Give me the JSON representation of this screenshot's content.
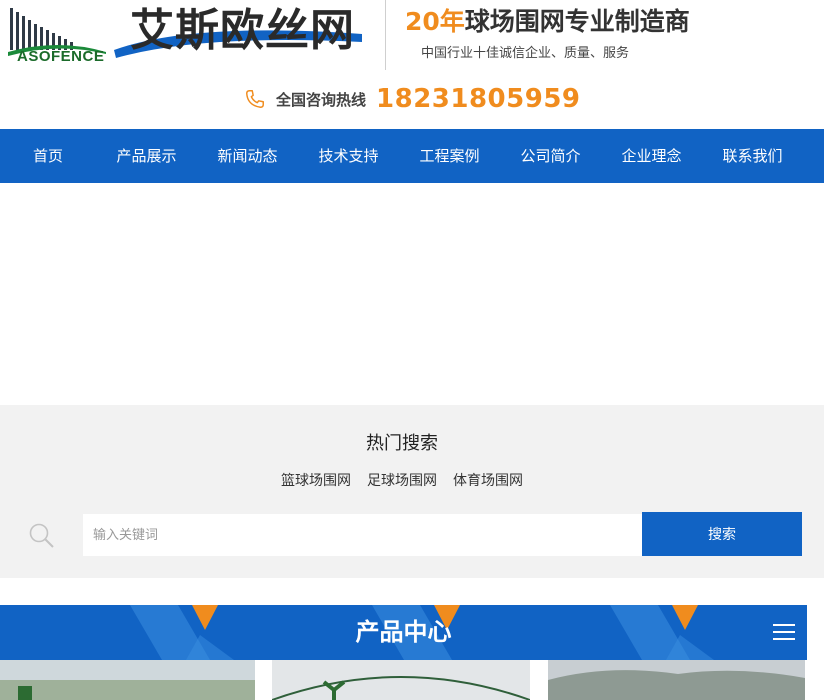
{
  "header": {
    "logo_text": "ASOFENCE",
    "brand_text": "艾斯欧丝网",
    "slogan_num": "20年",
    "slogan_rest": "球场围网专业制造商",
    "sub_slogan": "中国行业十佳诚信企业、质量、服务",
    "hotline_label": "全国咨询热线",
    "hotline_number": "18231805959"
  },
  "nav": {
    "items": [
      {
        "label": "首页"
      },
      {
        "label": "产品展示"
      },
      {
        "label": "新闻动态"
      },
      {
        "label": "技术支持"
      },
      {
        "label": "工程案例"
      },
      {
        "label": "公司简介"
      },
      {
        "label": "企业理念"
      },
      {
        "label": "联系我们"
      }
    ]
  },
  "search": {
    "hot_title": "热门搜索",
    "hot_links": [
      "篮球场围网",
      "足球场围网",
      "体育场围网"
    ],
    "placeholder": "输入关键词",
    "button_label": "搜索"
  },
  "products": {
    "title": "产品中心"
  },
  "colors": {
    "primary": "#1163c4",
    "accent": "#f08c1e",
    "search_bg": "#f2f2f2"
  },
  "icons": {
    "phone": "phone-icon",
    "search": "search-icon",
    "menu": "menu-icon"
  }
}
